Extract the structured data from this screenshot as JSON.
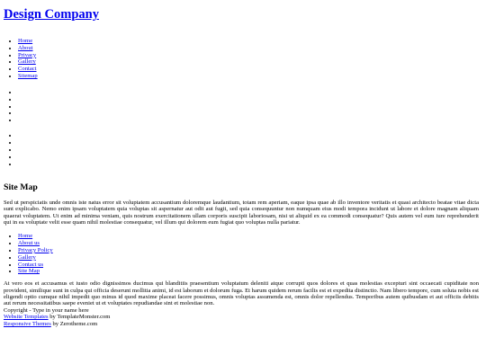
{
  "site": {
    "title": "Design Company"
  },
  "nav": {
    "items": [
      {
        "label": "Home"
      },
      {
        "label": "About"
      },
      {
        "label": "Privacy"
      },
      {
        "label": "Gallery"
      },
      {
        "label": "Contact"
      },
      {
        "label": "Sitemap"
      }
    ]
  },
  "main": {
    "heading": "Site Map",
    "intro": "Sed ut perspiciatis unde omnis iste natus error sit voluptatem accusantium doloremque laudantium, totam rem aperiam, eaque ipsa quae ab illo inventore veritatis et quasi architecto beatae vitae dicta sunt explicabo. Nemo enim ipsam voluptatem quia voluptas sit aspernatur aut odit aut fugit, sed quia consequuntur non numquam eius modi tempora incidunt ut labore et dolore magnam aliquam quaerat voluptatem. Ut enim ad minima veniam, quis nostrum exercitationem ullam corporis suscipit laboriosam, nisi ut aliquid ex ea commodi consequatur? Quis autem vel eum iure reprehenderit qui in ea voluptate velit esse quam nihil molestiae consequatur, vel illum qui dolorem eum fugiat quo voluptas nulla pariatur.",
    "sitemap_links": [
      {
        "label": "Home"
      },
      {
        "label": "About us"
      },
      {
        "label": "Privacy Policy"
      },
      {
        "label": "Gallery"
      },
      {
        "label": "Contact us"
      },
      {
        "label": "Site Map"
      }
    ],
    "body": "At vero eos et accusamus et iusto odio dignissimos ducimus qui blanditiis praesentium voluptatum deleniti atque corrupti quos dolores et quas molestias excepturi sint occaecati cupiditate non provident, similique sunt in culpa qui officia deserunt mollitia animi, id est laborum et dolorum fuga. Et harum quidem rerum facilis est et expedita distinctio. Nam libero tempore, cum soluta nobis est eligendi optio cumque nihil impedit quo minus id quod maxime placeat facere possimus, omnis voluptas assumenda est, omnis dolor repellendus. Temporibus autem quibusdam et aut officiis debitis aut rerum necessitatibus saepe eveniet ut et voluptates repudiandae sint et molestiae non."
  },
  "footer": {
    "copyright": "Copyright - Type in your name here",
    "credit1_link": "Website Templates",
    "credit1_text": " by TemplateMonster.com",
    "credit2_link": "Responsive Themes",
    "credit2_text": " by Zerotheme.com"
  }
}
